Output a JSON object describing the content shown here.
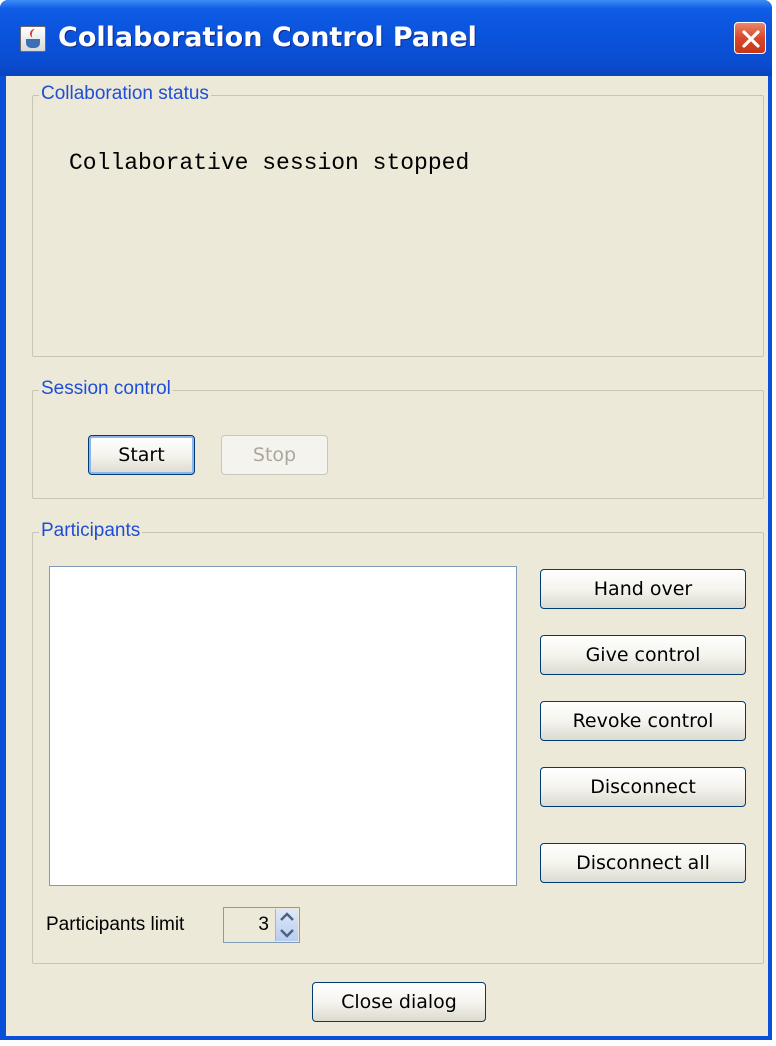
{
  "window": {
    "title": "Collaboration Control Panel"
  },
  "status_group": {
    "label": "Collaboration status",
    "text": "Collaborative session stopped"
  },
  "session_group": {
    "label": "Session control",
    "start_label": "Start",
    "stop_label": "Stop"
  },
  "participants_group": {
    "label": "Participants",
    "buttons": {
      "hand_over": "Hand over",
      "give_control": "Give control",
      "revoke_control": "Revoke control",
      "disconnect": "Disconnect",
      "disconnect_all": "Disconnect all"
    },
    "limit_label": "Participants limit",
    "limit_value": "3"
  },
  "footer": {
    "close_label": "Close dialog"
  },
  "icons": {
    "app": "java-coffee-cup-icon",
    "close": "close-x-icon",
    "spin_up": "spin-up-arrow-icon",
    "spin_down": "spin-down-arrow-icon"
  },
  "colors": {
    "titlebar": "#0a52da",
    "group_label": "#1f4ed6",
    "dialog_bg": "#ece9d8",
    "close_button": "#d9472a"
  }
}
